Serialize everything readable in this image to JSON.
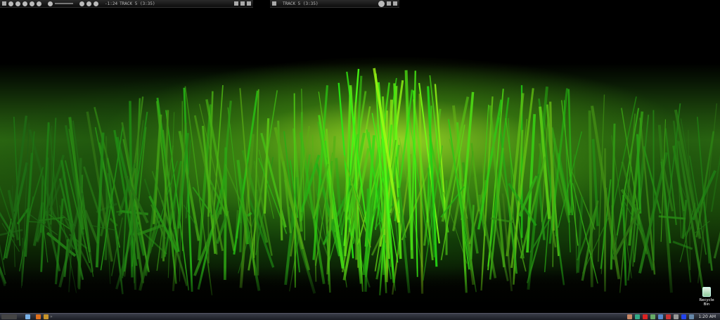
{
  "player1": {
    "time": "-1:24",
    "track": "TRACK 5 (3:35)"
  },
  "player2": {
    "track": "TRACK 5 (3:35)"
  },
  "desktop": {
    "recycle_bin_label": "Recycle Bin"
  },
  "taskbar": {
    "clock": "1:20 AM",
    "quicklaunch": [
      "start-icon",
      "ie-icon",
      "firefox-icon",
      "winamp-icon"
    ],
    "tray": [
      "network-icon",
      "shield-icon",
      "antivirus-icon",
      "volume-icon",
      "messenger-icon",
      "security-icon",
      "media-icon",
      "display-icon"
    ]
  }
}
